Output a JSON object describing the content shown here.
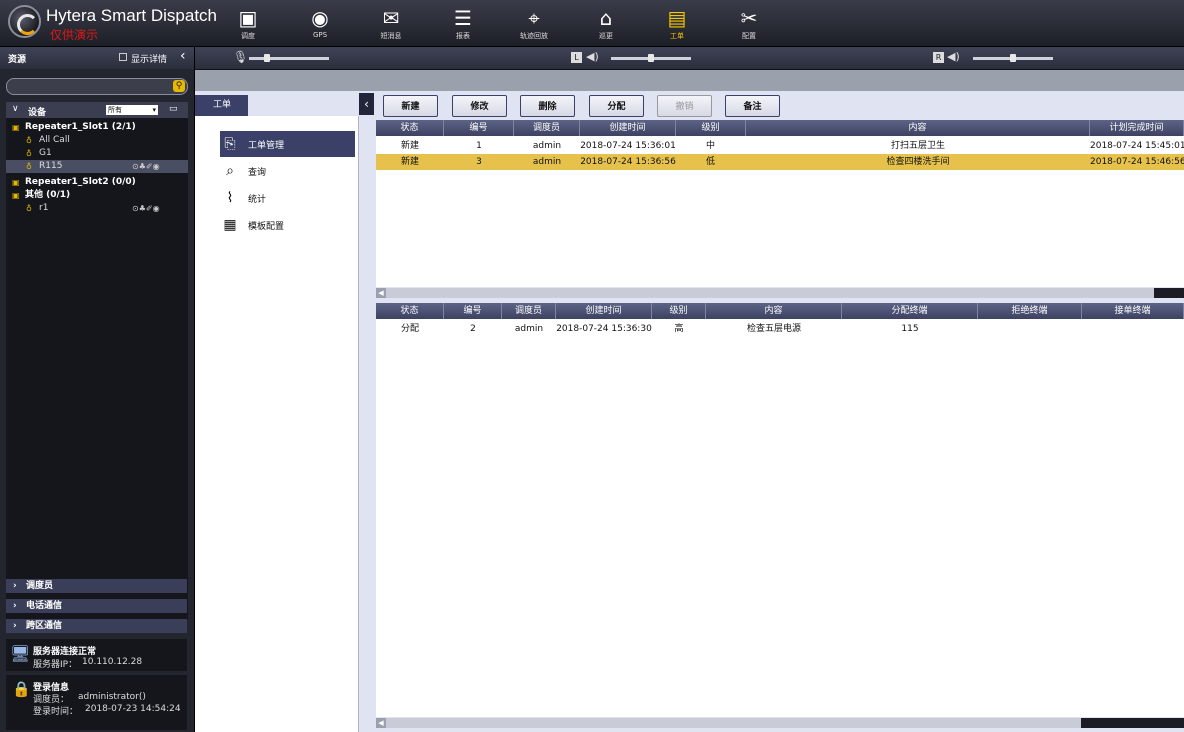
{
  "app": {
    "title": "Hytera Smart Dispatch",
    "watermark": "仅供演示"
  },
  "nav": [
    {
      "label": "调度",
      "icon": "dispatch-icon",
      "glyph": "▣"
    },
    {
      "label": "GPS",
      "icon": "globe-icon",
      "glyph": "◉"
    },
    {
      "label": "短消息",
      "icon": "message-icon",
      "glyph": "✉"
    },
    {
      "label": "报表",
      "icon": "report-icon",
      "glyph": "☰"
    },
    {
      "label": "轨迹回放",
      "icon": "track-icon",
      "glyph": "⌖"
    },
    {
      "label": "巡更",
      "icon": "patrol-icon",
      "glyph": "⌂"
    },
    {
      "label": "工单",
      "icon": "workorder-icon",
      "glyph": "▤",
      "active": true
    },
    {
      "label": "配置",
      "icon": "tools-icon",
      "glyph": "✂"
    }
  ],
  "sidebar": {
    "title": "资源",
    "show_detail": "显示详情",
    "device_header": "设备",
    "filter": "所有",
    "tree": [
      {
        "text": "Repeater1_Slot1 (2/1)",
        "level": 0,
        "bold": true,
        "icon": "repeater-icon"
      },
      {
        "text": "All Call",
        "level": 1,
        "icon": "group-call-icon"
      },
      {
        "text": "G1",
        "level": 1,
        "icon": "group-icon"
      },
      {
        "text": "R115",
        "level": 1,
        "icon": "radio-icon",
        "selected": true,
        "status": "⊙♣✐◉"
      },
      {
        "text": "Repeater1_Slot2 (0/0)",
        "level": 0,
        "bold": true,
        "icon": "repeater-icon"
      },
      {
        "text": "其他 (0/1)",
        "level": 0,
        "bold": true,
        "icon": "more-icon"
      },
      {
        "text": "r1",
        "level": 1,
        "icon": "user-icon",
        "status": "⊙♣✐◉"
      }
    ],
    "accordions": [
      "调度员",
      "电话通信",
      "跨区通信"
    ],
    "server": {
      "status": "服务器连接正常",
      "ip_label": "服务器IP：",
      "ip": "10.110.12.28"
    },
    "login": {
      "title": "登录信息",
      "user_label": "调度员：",
      "user": "administrator()",
      "time_label": "登录时间：",
      "time": "2018-07-23 14:54:24"
    }
  },
  "workorder": {
    "tab": "工单",
    "menu": [
      {
        "label": "工单管理",
        "icon": "workorder-manage-icon",
        "glyph": "⎘",
        "selected": true
      },
      {
        "label": "查询",
        "icon": "query-icon",
        "glyph": "⌕"
      },
      {
        "label": "统计",
        "icon": "chart-icon",
        "glyph": "⌇"
      },
      {
        "label": "模板配置",
        "icon": "template-icon",
        "glyph": "▦"
      }
    ],
    "toolbar": [
      {
        "label": "新建"
      },
      {
        "label": "修改"
      },
      {
        "label": "删除"
      },
      {
        "label": "分配"
      },
      {
        "label": "撤销",
        "disabled": true
      },
      {
        "label": "备注"
      }
    ],
    "table1": {
      "columns": [
        "状态",
        "编号",
        "调度员",
        "创建时间",
        "级别",
        "内容",
        "计划完成时间"
      ],
      "rows": [
        [
          "新建",
          "1",
          "admin",
          "2018-07-24 15:36:01",
          "中",
          "打扫五层卫生",
          "2018-07-24 15:45:01"
        ],
        [
          "新建",
          "3",
          "admin",
          "2018-07-24 15:36:56",
          "低",
          "检查四楼洗手间",
          "2018-07-24 15:46:56"
        ]
      ],
      "selected_row": 1
    },
    "table2": {
      "columns": [
        "状态",
        "编号",
        "调度员",
        "创建时间",
        "级别",
        "内容",
        "分配终端",
        "拒绝终端",
        "接单终端"
      ],
      "rows": [
        [
          "分配",
          "2",
          "admin",
          "2018-07-24 15:36:30",
          "高",
          "检查五层电源",
          "115",
          "",
          ""
        ]
      ]
    }
  }
}
